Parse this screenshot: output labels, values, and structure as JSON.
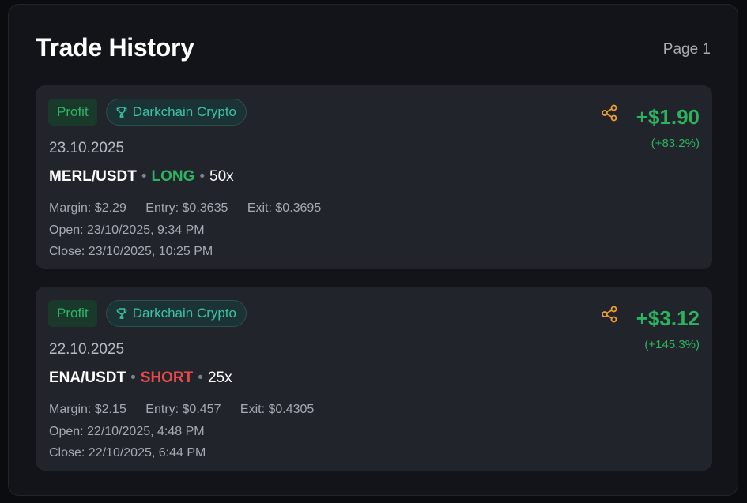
{
  "header": {
    "title": "Trade History",
    "page": "Page 1"
  },
  "colors": {
    "profit": "#2cb35e",
    "long": "#2db35f",
    "short": "#e84a4a",
    "share_icon": "#f0a030",
    "team": "#3cc2a6"
  },
  "trades": [
    {
      "status": "Profit",
      "team": "Darkchain Crypto",
      "team_icon": "trophy-icon",
      "date": "23.10.2025",
      "pair": "MERL/USDT",
      "sep1": "•",
      "side": "LONG",
      "sep2": "•",
      "leverage": "50x",
      "margin": "Margin: $2.29",
      "entry": "Entry: $0.3635",
      "exit": "Exit: $0.3695",
      "open": "Open: 23/10/2025, 9:34 PM",
      "close": "Close: 23/10/2025, 10:25 PM",
      "pnl": "+$1.90",
      "pnl_pct": "(+83.2%)",
      "share_icon": "share-icon"
    },
    {
      "status": "Profit",
      "team": "Darkchain Crypto",
      "team_icon": "trophy-icon",
      "date": "22.10.2025",
      "pair": "ENA/USDT",
      "sep1": "•",
      "side": "SHORT",
      "sep2": "•",
      "leverage": "25x",
      "margin": "Margin: $2.15",
      "entry": "Entry: $0.457",
      "exit": "Exit: $0.4305",
      "open": "Open: 22/10/2025, 4:48 PM",
      "close": "Close: 22/10/2025, 6:44 PM",
      "pnl": "+$3.12",
      "pnl_pct": "(+145.3%)",
      "share_icon": "share-icon"
    }
  ]
}
